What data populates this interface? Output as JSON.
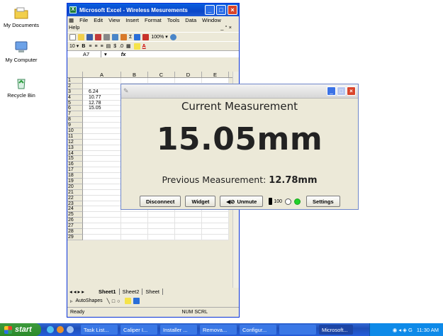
{
  "desktop": {
    "icons": [
      {
        "label": "My Documents",
        "icon": "folder-icon"
      },
      {
        "label": "My Computer",
        "icon": "computer-icon"
      },
      {
        "label": "Recycle Bin",
        "icon": "recycle-bin-icon"
      }
    ]
  },
  "excel": {
    "title": "Microsoft Excel - Wireless Mesurements",
    "menu": [
      "File",
      "Edit",
      "View",
      "Insert",
      "Format",
      "Tools",
      "Data",
      "Window"
    ],
    "help": "Help",
    "doc_controls": "_ ° ×",
    "zoom": "100%",
    "font_size": "10",
    "name_box": "A7",
    "fx": "fx",
    "columns": [
      "A",
      "B",
      "C",
      "D",
      "E"
    ],
    "rows": [
      "1",
      "2",
      "3",
      "4",
      "5",
      "6",
      "7",
      "8",
      "9",
      "10",
      "11",
      "12",
      "13",
      "14",
      "15",
      "16",
      "17",
      "18",
      "19",
      "20",
      "21",
      "22",
      "23",
      "24",
      "25",
      "26",
      "27",
      "28",
      "29"
    ],
    "cells": {
      "3": "6.24",
      "4": "10.77",
      "5": "12.78",
      "6": "15.05"
    },
    "sheets": [
      "Sheet1",
      "Sheet2",
      "Sheet"
    ],
    "autoshapes": "AutoShapes",
    "status_left": "Ready",
    "status_right": "NUM SCRL"
  },
  "dialog": {
    "heading": "Current Measurement",
    "value": "15.05mm",
    "previous_label": "Previous Measurement:",
    "previous_value": "12.78mm",
    "buttons": {
      "disconnect": "Disconnect",
      "widget": "Widget",
      "unmute": "Unmute",
      "settings": "Settings"
    },
    "battery": "100"
  },
  "taskbar": {
    "start": "start",
    "items": [
      "Task List...",
      "Caliper I...",
      "Installer ...",
      "Remova...",
      "Configur...",
      "",
      "Microsoft..."
    ],
    "clock": "11:30 AM"
  },
  "colors": {
    "xp_blue": "#245edc",
    "start_green": "#2b8a2b",
    "status_green": "#22d12a"
  }
}
